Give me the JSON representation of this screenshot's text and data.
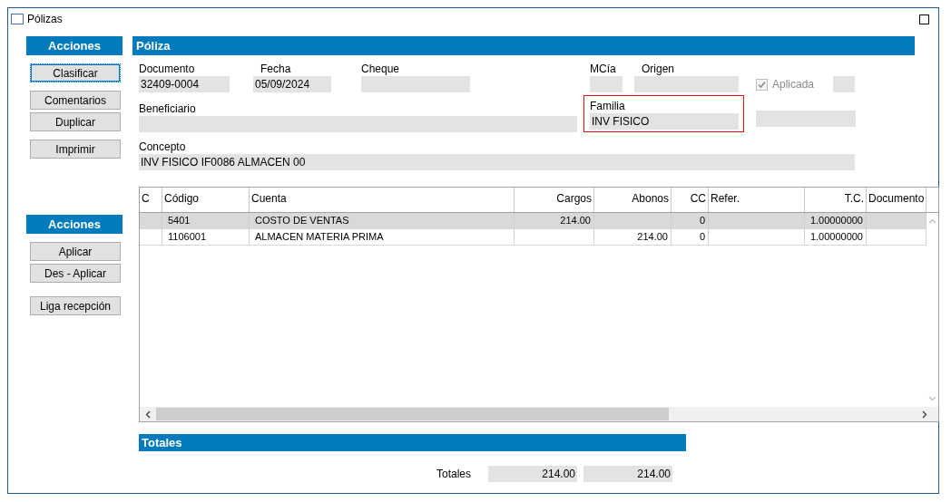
{
  "window": {
    "title": "Pólizas"
  },
  "sidebar": {
    "sections": [
      {
        "header": "Acciones",
        "groups": [
          [
            {
              "label": "Clasificar",
              "focused": true
            }
          ],
          [
            {
              "label": "Comentarios",
              "focused": false
            },
            {
              "label": "Duplicar",
              "focused": false
            }
          ],
          [
            {
              "label": "Imprimir",
              "focused": false
            }
          ]
        ]
      },
      {
        "header": "Acciones",
        "groups": [
          [
            {
              "label": "Aplicar",
              "focused": false
            },
            {
              "label": "Des - Aplicar",
              "focused": false
            }
          ],
          [
            {
              "label": "Liga recepción",
              "focused": false
            }
          ]
        ]
      }
    ]
  },
  "poliza": {
    "header": "Póliza",
    "documento": {
      "label": "Documento",
      "value": "32409-0004"
    },
    "fecha": {
      "label": "Fecha",
      "value": "05/09/2024"
    },
    "cheque": {
      "label": "Cheque"
    },
    "mcia": {
      "label": "MCía"
    },
    "origen": {
      "label": "Origen"
    },
    "aplicada": {
      "label": "Aplicada",
      "checked": true,
      "disabled": true
    },
    "beneficiario": {
      "label": "Beneficiario"
    },
    "familia": {
      "label": "Familia",
      "value": "INV FISICO",
      "highlighted": true
    },
    "concepto": {
      "label": "Concepto",
      "value": "INV FISICO IF0086 ALMACEN 00"
    }
  },
  "table": {
    "columns": [
      {
        "label": "C",
        "kind": "text"
      },
      {
        "label": "Código",
        "kind": "text"
      },
      {
        "label": "Cuenta",
        "kind": "text"
      },
      {
        "label": "Cargos",
        "kind": "number"
      },
      {
        "label": "Abonos",
        "kind": "number"
      },
      {
        "label": "CC",
        "kind": "number"
      },
      {
        "label": "Refer.",
        "kind": "text"
      },
      {
        "label": "T.C.",
        "kind": "number"
      },
      {
        "label": "Documento",
        "kind": "text"
      }
    ],
    "rows": [
      {
        "selected": true,
        "cells": [
          "",
          "5401",
          "COSTO DE VENTAS",
          "214.00",
          "",
          "0",
          "",
          "1.00000000",
          ""
        ]
      },
      {
        "selected": false,
        "cells": [
          "",
          "1106001",
          "ALMACEN MATERIA PRIMA",
          "",
          "214.00",
          "0",
          "",
          "1.00000000",
          ""
        ]
      }
    ]
  },
  "totales": {
    "header": "Totales",
    "label": "Totales",
    "cargos": "214.00",
    "abonos": "214.00"
  }
}
